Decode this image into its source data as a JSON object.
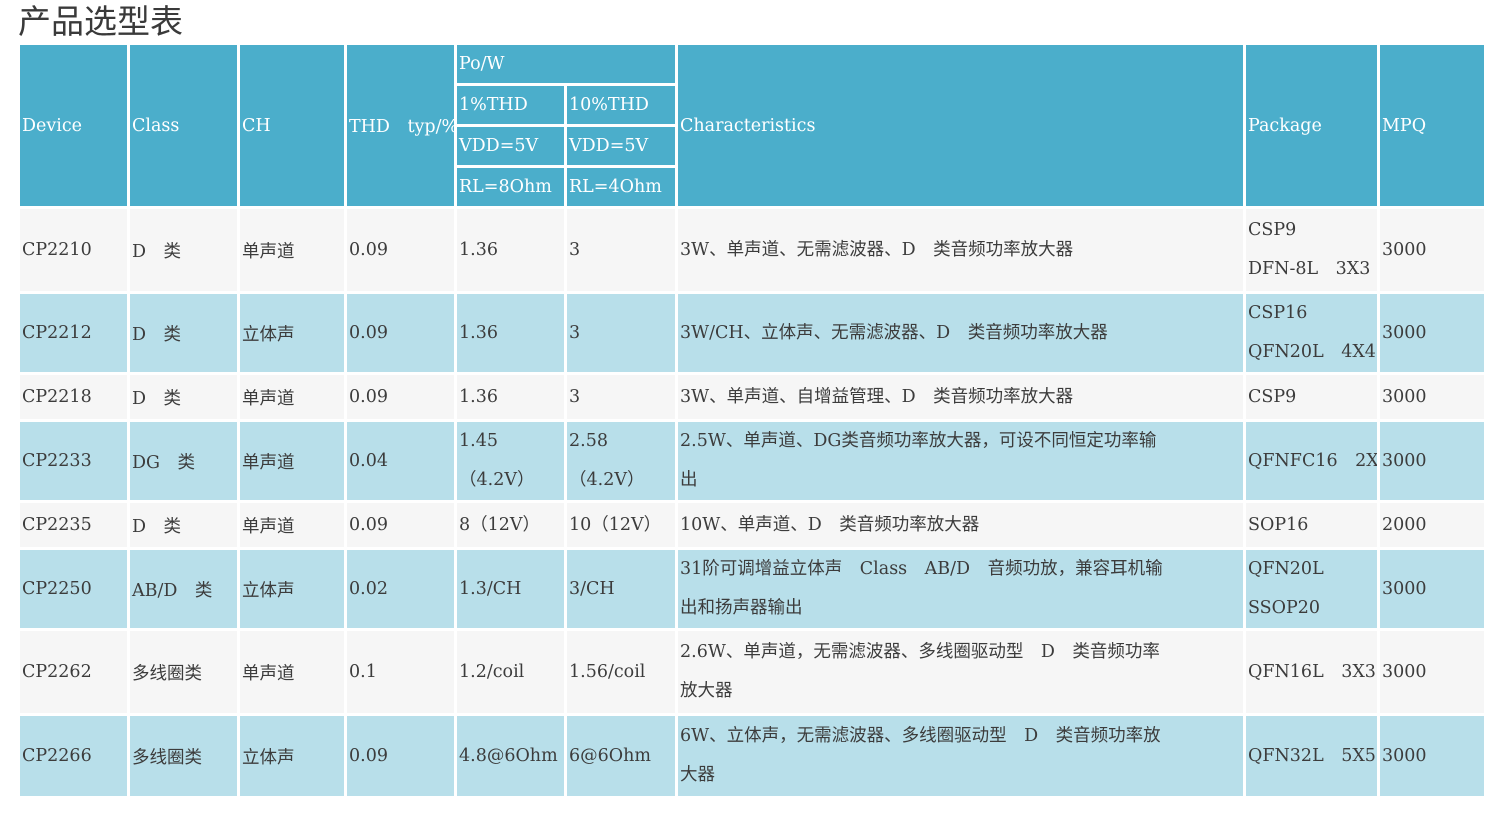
{
  "title": "产品选型表",
  "header": {
    "device": "Device",
    "class": "Class",
    "ch": "CH",
    "thd": "THD　typ/%",
    "po_w": "Po/W",
    "thd1": "1%THD",
    "thd10": "10%THD",
    "vdd_1": "VDD=5V",
    "vdd_10": "VDD=5V",
    "rl_1": "RL=8Ohm",
    "rl_10": "RL=4Ohm",
    "characteristics": "Characteristics",
    "package": "Package",
    "mpq": "MPQ"
  },
  "rows": [
    {
      "device": "CP2210",
      "class": "D　类",
      "ch": "单声道",
      "thd": "0.09",
      "po1": [
        "1.36"
      ],
      "po10": [
        "3"
      ],
      "characteristics": [
        "3W、单声道、无需滤波器、D　类音频功率放大器"
      ],
      "package": [
        "CSP9",
        "DFN-8L　3X3"
      ],
      "mpq": "3000"
    },
    {
      "device": "CP2212",
      "class": "D　类",
      "ch": "立体声",
      "thd": "0.09",
      "po1": [
        "1.36"
      ],
      "po10": [
        "3"
      ],
      "characteristics": [
        "3W/CH、立体声、无需滤波器、D　类音频功率放大器"
      ],
      "package": [
        "CSP16",
        "QFN20L　4X4"
      ],
      "mpq": "3000"
    },
    {
      "device": "CP2218",
      "class": "D　类",
      "ch": "单声道",
      "thd": "0.09",
      "po1": [
        "1.36"
      ],
      "po10": [
        "3"
      ],
      "characteristics": [
        "3W、单声道、自增益管理、D　类音频功率放大器"
      ],
      "package": [
        "CSP9"
      ],
      "mpq": "3000"
    },
    {
      "device": "CP2233",
      "class": "DG　类",
      "ch": "单声道",
      "thd": "0.04",
      "po1": [
        "1.45",
        "（4.2V）"
      ],
      "po10": [
        "2.58",
        "（4.2V）"
      ],
      "characteristics": [
        "2.5W、单声道、DG类音频功率放大器，可设不同恒定功率输",
        "出"
      ],
      "package": [
        "QFNFC16　2X2"
      ],
      "mpq": "3000"
    },
    {
      "device": "CP2235",
      "class": "D　类",
      "ch": "单声道",
      "thd": "0.09",
      "po1": [
        "8（12V）"
      ],
      "po10": [
        "10（12V）"
      ],
      "characteristics": [
        "10W、单声道、D　类音频功率放大器"
      ],
      "package": [
        "SOP16"
      ],
      "mpq": "2000"
    },
    {
      "device": "CP2250",
      "class": "AB/D　类",
      "ch": "立体声",
      "thd": "0.02",
      "po1": [
        "1.3/CH"
      ],
      "po10": [
        "3/CH"
      ],
      "characteristics": [
        "31阶可调增益立体声　Class　AB/D　音频功放，兼容耳机输",
        "出和扬声器输出"
      ],
      "package": [
        "QFN20L",
        "SSOP20"
      ],
      "mpq": "3000"
    },
    {
      "device": "CP2262",
      "class": "多线圈类",
      "ch": "单声道",
      "thd": "0.1",
      "po1": [
        "1.2/coil"
      ],
      "po10": [
        "1.56/coil"
      ],
      "characteristics": [
        "2.6W、单声道，无需滤波器、多线圈驱动型　D　类音频功率",
        "放大器"
      ],
      "package": [
        "QFN16L　3X3"
      ],
      "mpq": "3000"
    },
    {
      "device": "CP2266",
      "class": "多线圈类",
      "ch": "立体声",
      "thd": "0.09",
      "po1": [
        "4.8@6Ohm"
      ],
      "po10": [
        "6@6Ohm"
      ],
      "characteristics": [
        "6W、立体声，无需滤波器、多线圈驱动型　D　类音频功率放",
        "大器"
      ],
      "package": [
        "QFN32L　5X5"
      ],
      "mpq": "3000"
    }
  ]
}
